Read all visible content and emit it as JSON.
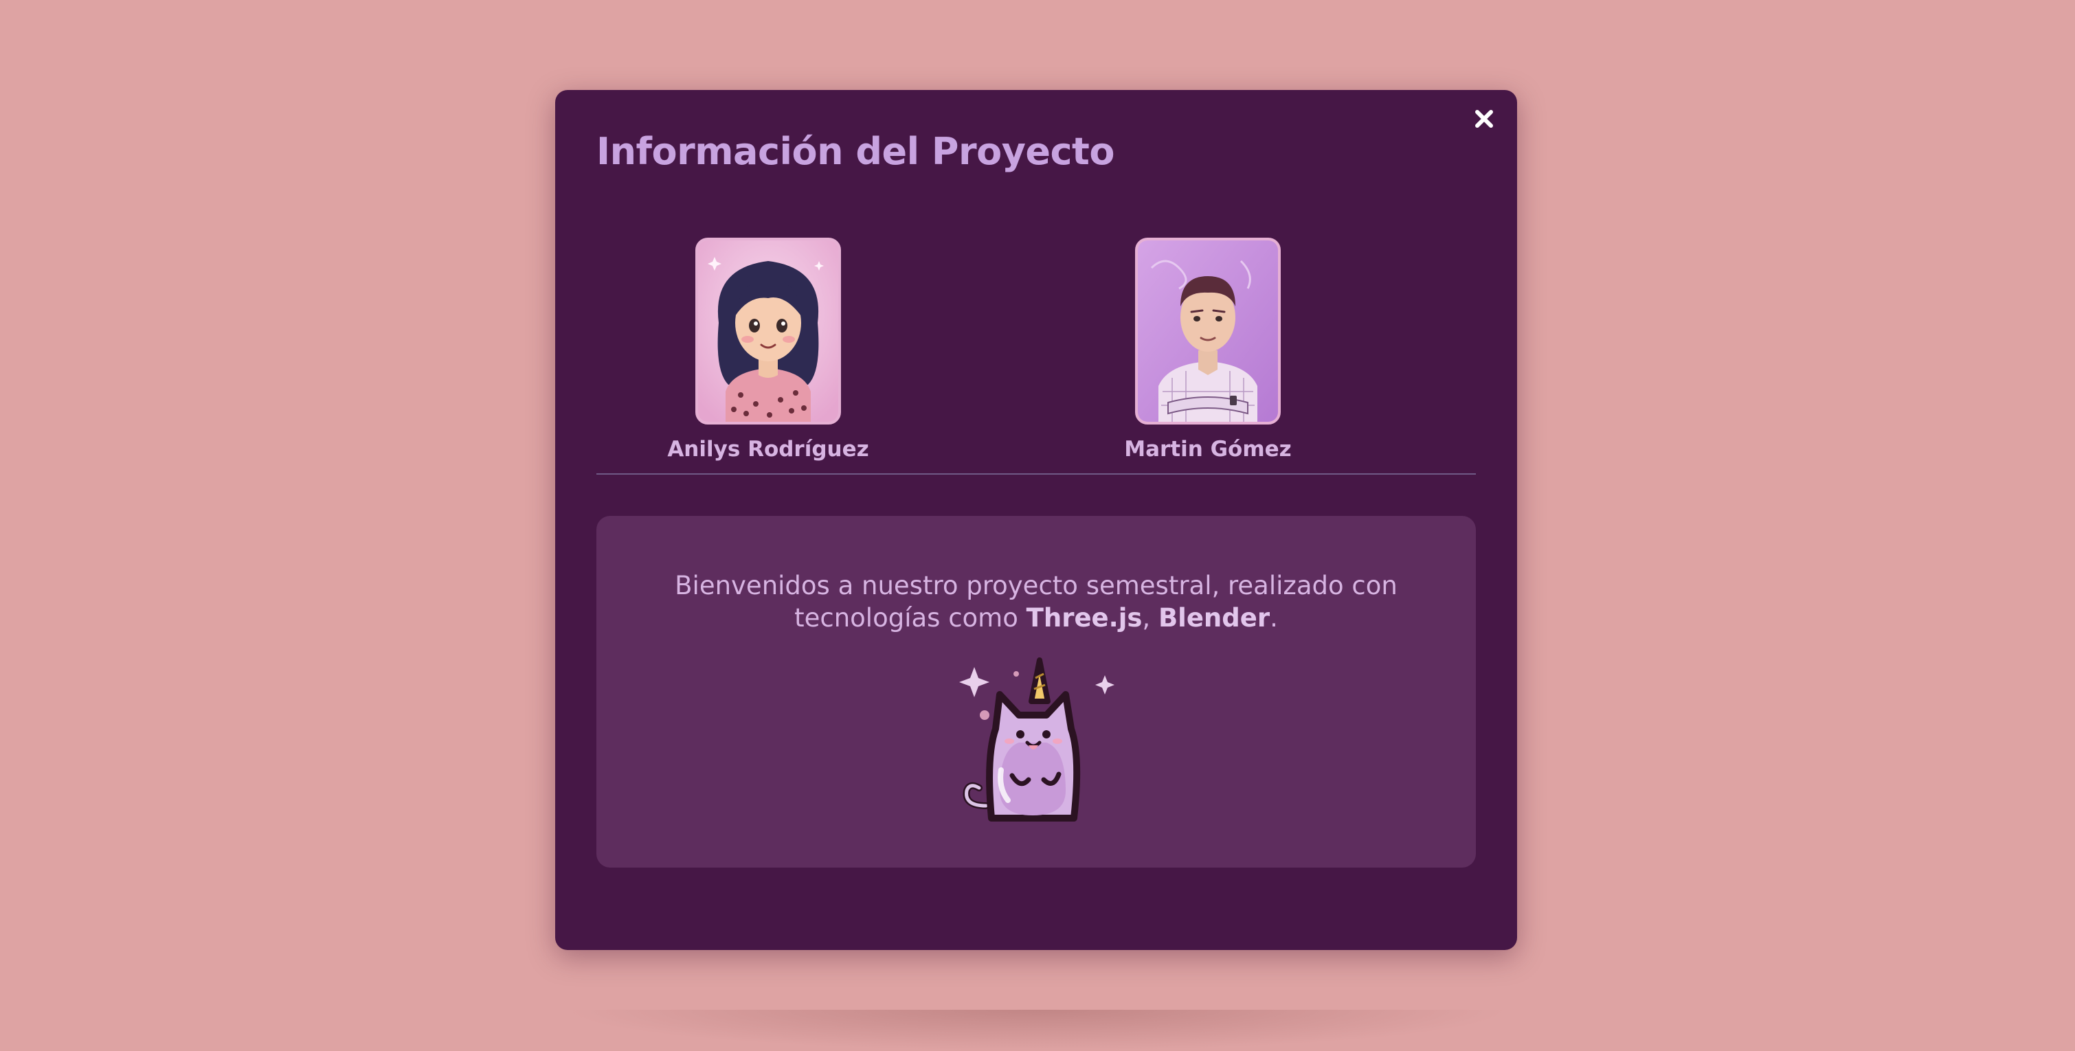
{
  "modal": {
    "title": "Información del Proyecto",
    "close_icon": "close-icon"
  },
  "team": [
    {
      "name": "Anilys Rodríguez",
      "avatar_icon": "girl-portrait"
    },
    {
      "name": "Martin Gómez",
      "avatar_icon": "boy-portrait"
    }
  ],
  "info": {
    "text_before": "Bienvenidos a nuestro proyecto semestral, realizado con tecnologías como ",
    "tech_1": "Three.js",
    "separator": ", ",
    "tech_2": "Blender",
    "text_after": ".",
    "mascot_icon": "unicorn-cat-icon"
  },
  "colors": {
    "page_background": "#dea3a3",
    "modal_background": "#461746",
    "card_background": "#5e2d5e",
    "accent_text": "#c8a3e0"
  }
}
